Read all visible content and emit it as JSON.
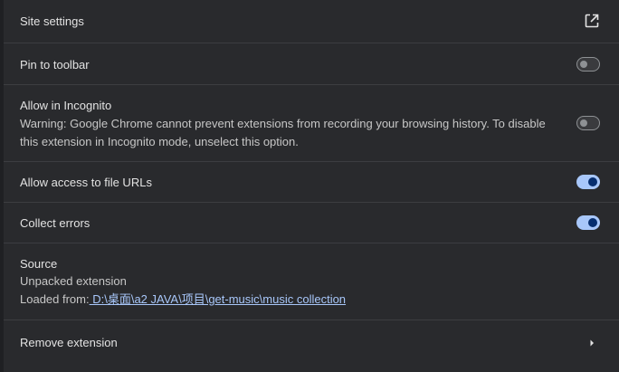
{
  "site_settings": {
    "label": "Site settings",
    "icon": "open-in-new-icon"
  },
  "pin_toolbar": {
    "label": "Pin to toolbar",
    "enabled": false
  },
  "incognito": {
    "label": "Allow in Incognito",
    "warning": "Warning: Google Chrome cannot prevent extensions from recording your browsing history. To disable this extension in Incognito mode, unselect this option.",
    "enabled": false
  },
  "file_urls": {
    "label": "Allow access to file URLs",
    "enabled": true
  },
  "collect_errors": {
    "label": "Collect errors",
    "enabled": true
  },
  "source": {
    "label": "Source",
    "type": "Unpacked extension",
    "loaded_from_label": "Loaded from:",
    "path": " D:\\桌面\\a2 JAVA\\项目\\get-music\\music collection"
  },
  "remove": {
    "label": "Remove extension",
    "icon": "chevron-right-icon"
  },
  "colors": {
    "accent": "#a8c7fa",
    "toggle_knob_on": "#062e6f",
    "background": "#292a2d"
  }
}
